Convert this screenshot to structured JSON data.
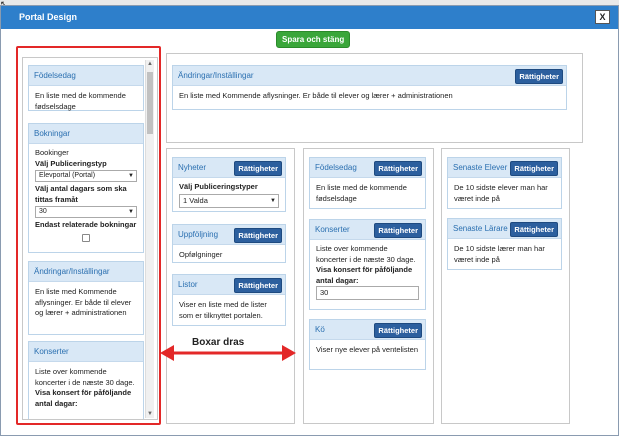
{
  "window": {
    "title": "Portal Design",
    "close_label": "X"
  },
  "toolbar": {
    "save_label": "Spara och stäng"
  },
  "rights_label": "Rättigheter",
  "left_column": {
    "widgets": [
      {
        "title": "Födelsedag",
        "text": "En liste med de kommende fødselsdage"
      },
      {
        "title": "Bokningar",
        "text": "Bookinger",
        "pub_type_label": "Välj Publiceringstyp",
        "pub_type_value": "Elevportal (Portal)",
        "days_label": "Välj antal dagars som ska tittas framåt",
        "days_value": "30",
        "related_label": "Endast relaterade bokningar"
      },
      {
        "title": "Ändringar/Inställingar",
        "text": "En liste med Kommende aflysninger. Er både til elever og lærer + administrationen"
      },
      {
        "title": "Konserter",
        "text": "Liste over kommende koncerter i de næste 30 dage.",
        "days_label": "Visa konsert för påföljande antal dagar:"
      }
    ]
  },
  "top_column": {
    "widget": {
      "title": "Ändringar/Inställingar",
      "text": "En liste med Kommende aflysninger. Er både til elever og lærer + administrationen"
    }
  },
  "column_a": {
    "widgets": [
      {
        "title": "Nyheter",
        "pub_types_label": "Välj Publiceringstyper",
        "pub_types_value": "1 Valda"
      },
      {
        "title": "Uppföljning",
        "text": "Opfølgninger"
      },
      {
        "title": "Listor",
        "text": "Viser en liste med de lister som er tilknyttet portalen."
      }
    ]
  },
  "column_b": {
    "widgets": [
      {
        "title": "Födelsedag",
        "text": "En liste med de kommende fødselsdage"
      },
      {
        "title": "Konserter",
        "text": "Liste over kommende koncerter i de næste 30 dage.",
        "days_label": "Visa konsert för påföljande antal dagar:",
        "days_value": "30"
      },
      {
        "title": "Kö",
        "text": "Viser nye elever på ventelisten"
      }
    ]
  },
  "column_c": {
    "widgets": [
      {
        "title": "Senaste Elever",
        "text": "De 10 sidste elever man har været inde på"
      },
      {
        "title": "Senaste Lärare",
        "text": "De 10 sidste lærer man har været inde på"
      }
    ]
  },
  "annotation": {
    "text": "Boxar dras"
  },
  "colors": {
    "titlebar": "#2e7fcb",
    "save": "#3aa63a",
    "rights": "#2c5f9e",
    "highlight": "#e32828"
  }
}
